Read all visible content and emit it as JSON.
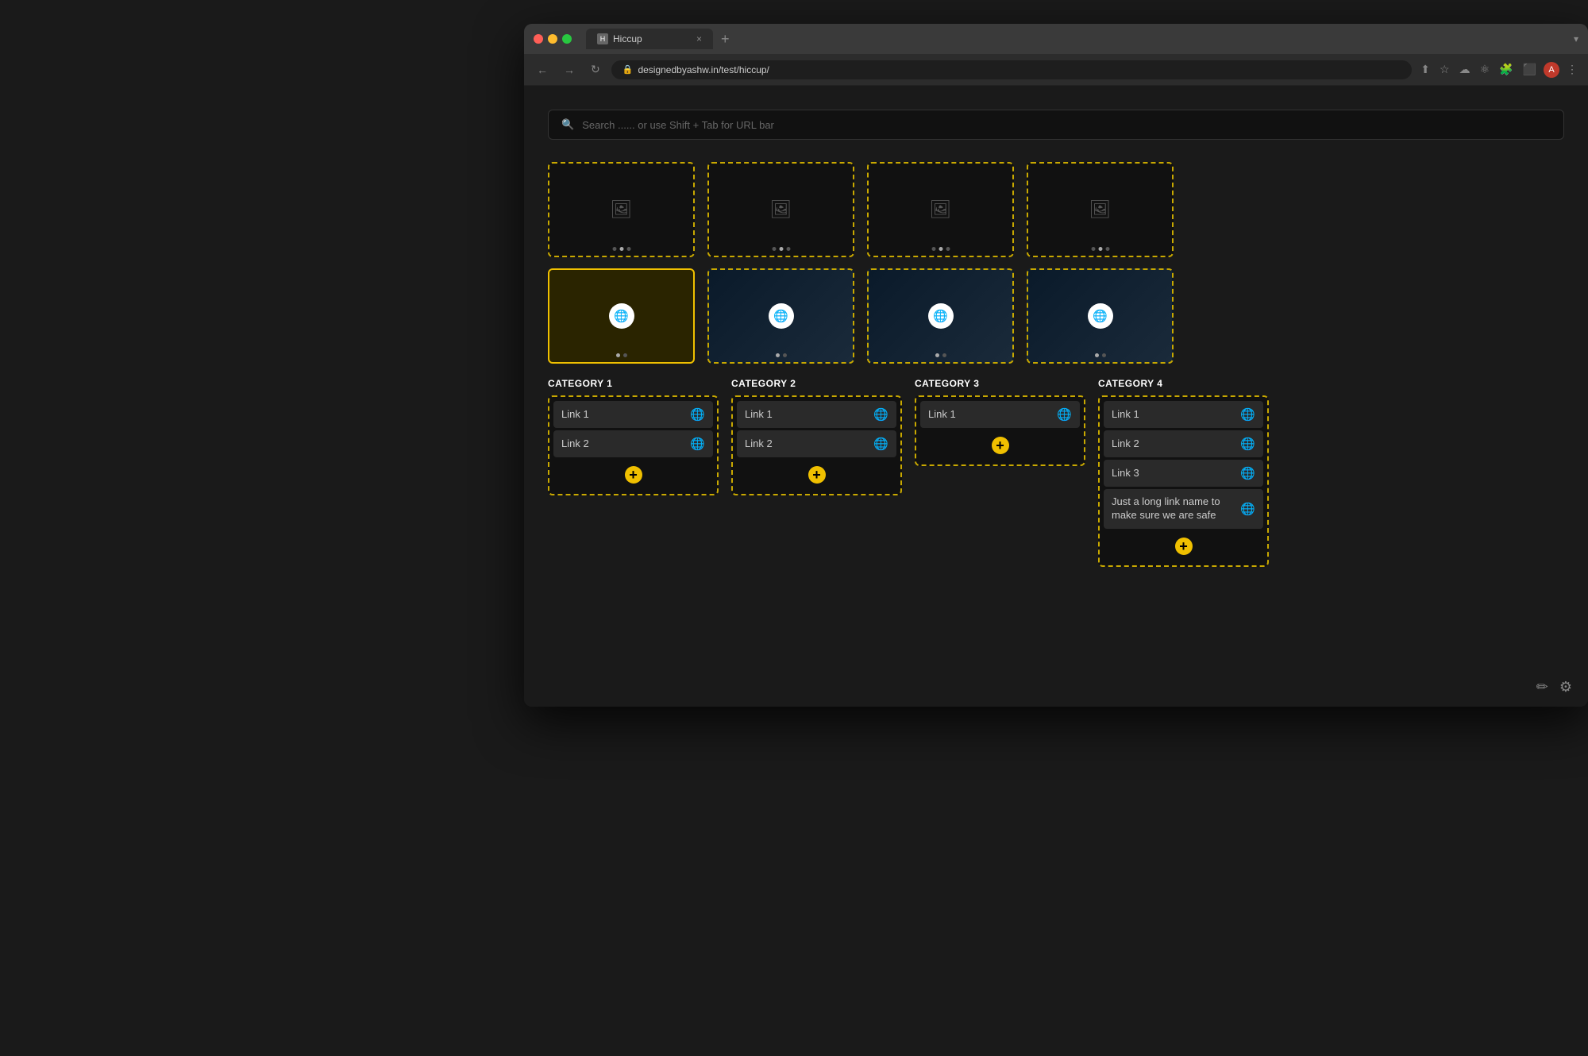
{
  "browser": {
    "tab_label": "Hiccup",
    "tab_close": "×",
    "tab_new": "+",
    "tab_dropdown": "▾",
    "nav_back": "←",
    "nav_forward": "→",
    "nav_refresh": "↻",
    "address_lock": "🔒",
    "address_url": "designedbyashw.in/test/hiccup/",
    "addr_share": "⬆",
    "addr_star": "☆",
    "addr_icon1": "☁",
    "addr_icon2": "⚛",
    "addr_icon3": "🧩",
    "addr_icon4": "⬛",
    "addr_menu": "⋮"
  },
  "search": {
    "placeholder": "Search ...... or use Shift + Tab for URL bar",
    "icon": "🔍"
  },
  "bookmarks_row1": [
    {
      "id": "bm1",
      "type": "empty",
      "selected": false
    },
    {
      "id": "bm2",
      "type": "empty",
      "selected": false
    },
    {
      "id": "bm3",
      "type": "empty",
      "selected": false
    },
    {
      "id": "bm4",
      "type": "empty",
      "selected": false
    }
  ],
  "bookmarks_row2": [
    {
      "id": "bm5",
      "type": "image",
      "bg": "olive",
      "selected": true
    },
    {
      "id": "bm6",
      "type": "image",
      "bg": "dark-blue",
      "selected": false
    },
    {
      "id": "bm7",
      "type": "image",
      "bg": "dark-blue",
      "selected": false
    },
    {
      "id": "bm8",
      "type": "image",
      "bg": "dark-blue",
      "selected": false
    }
  ],
  "categories": [
    {
      "id": "cat1",
      "title": "CATEGORY 1",
      "links": [
        {
          "text": "Link 1"
        },
        {
          "text": "Link 2"
        }
      ],
      "add_label": "+"
    },
    {
      "id": "cat2",
      "title": "CATEGORY 2",
      "links": [
        {
          "text": "Link 1"
        },
        {
          "text": "Link 2"
        }
      ],
      "add_label": "+"
    },
    {
      "id": "cat3",
      "title": "CATEGORY 3",
      "links": [
        {
          "text": "Link 1"
        }
      ],
      "add_label": "+"
    },
    {
      "id": "cat4",
      "title": "CATEGORY 4",
      "links": [
        {
          "text": "Link 1"
        },
        {
          "text": "Link 2"
        },
        {
          "text": "Link 3"
        },
        {
          "text": "Just a long link name to make sure we are safe"
        }
      ],
      "add_label": "+"
    }
  ],
  "bottom_icons": {
    "edit": "✏",
    "settings": "⚙"
  }
}
